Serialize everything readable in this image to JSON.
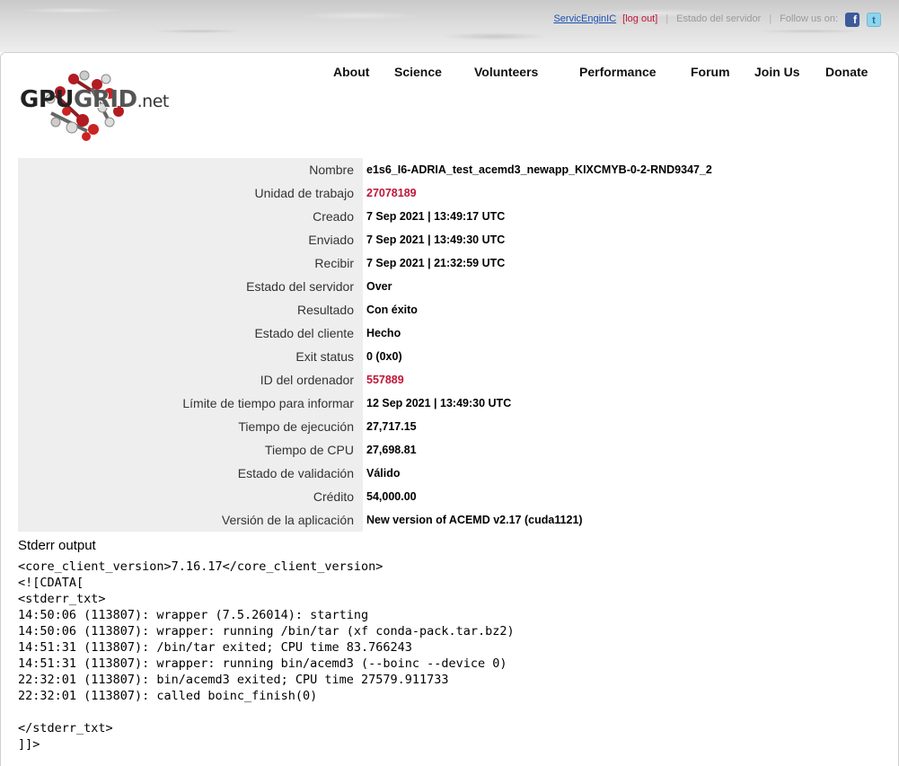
{
  "top_bar": {
    "user_link": "ServicEnginIC",
    "logout": "[log out]",
    "server_status": "Estado del servidor",
    "follow_us": "Follow us on:",
    "facebook_icon": "facebook-icon",
    "twitter_icon": "twitter-icon"
  },
  "logo": {
    "text_a": "GPU",
    "text_b": "GRID",
    "text_c": ".net"
  },
  "nav": {
    "items": [
      "About",
      "Science",
      "Volunteers",
      "Performance",
      "Forum",
      "Join Us",
      "Donate"
    ]
  },
  "details": {
    "rows": [
      {
        "label": "Nombre",
        "value": "e1s6_I6-ADRIA_test_acemd3_newapp_KIXCMYB-0-2-RND9347_2"
      },
      {
        "label": "Unidad de trabajo",
        "value": "27078189"
      },
      {
        "label": "Creado",
        "value": "7 Sep 2021 | 13:49:17 UTC"
      },
      {
        "label": "Enviado",
        "value": "7 Sep 2021 | 13:49:30 UTC"
      },
      {
        "label": "Recibir",
        "value": "7 Sep 2021 | 21:32:59 UTC"
      },
      {
        "label": "Estado del servidor",
        "value": "Over"
      },
      {
        "label": "Resultado",
        "value": "Con éxito"
      },
      {
        "label": "Estado del cliente",
        "value": "Hecho"
      },
      {
        "label": "Exit status",
        "value": "0 (0x0)"
      },
      {
        "label": "ID del ordenador",
        "value": "557889"
      },
      {
        "label": "Límite de tiempo para informar",
        "value": "12 Sep 2021 | 13:49:30 UTC"
      },
      {
        "label": "Tiempo de ejecución",
        "value": "27,717.15"
      },
      {
        "label": "Tiempo de CPU",
        "value": "27,698.81"
      },
      {
        "label": "Estado de validación",
        "value": "Válido"
      },
      {
        "label": "Crédito",
        "value": "54,000.00"
      },
      {
        "label": "Versión de la aplicación",
        "value": "New version of ACEMD v2.17 (cuda1121)"
      }
    ]
  },
  "stderr": {
    "title": "Stderr output",
    "lines": [
      "<core_client_version>7.16.17</core_client_version>",
      "<![CDATA[",
      "<stderr_txt>",
      "14:50:06 (113807): wrapper (7.5.26014): starting",
      "14:50:06 (113807): wrapper: running /bin/tar (xf conda-pack.tar.bz2)",
      "14:51:31 (113807): /bin/tar exited; CPU time 83.766243",
      "14:51:31 (113807): wrapper: running bin/acemd3 (--boinc --device 0)",
      "22:32:01 (113807): bin/acemd3 exited; CPU time 27579.911733",
      "22:32:01 (113807): called boinc_finish(0)",
      "",
      "</stderr_txt>",
      "]]>"
    ]
  },
  "colors": {
    "link_red": "#c0163a",
    "label_bg": "#eeeeee",
    "user_link_blue": "#1a4fb5"
  }
}
